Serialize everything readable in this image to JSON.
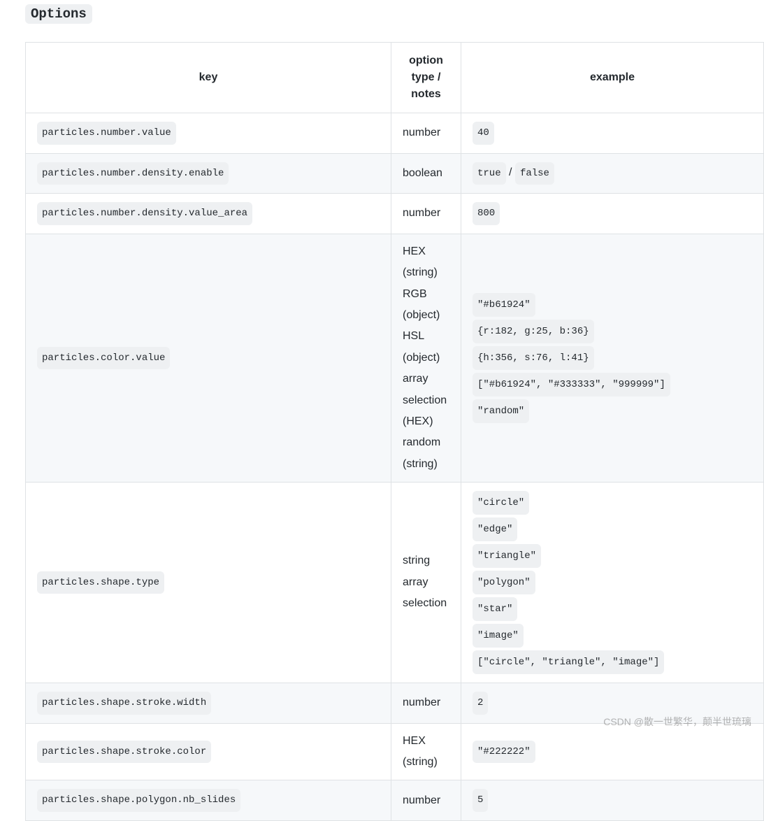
{
  "heading": "Options",
  "headers": {
    "key": "key",
    "type": "option type / notes",
    "example": "example"
  },
  "rows": [
    {
      "key": "particles.number.value",
      "type": "number",
      "examples": [
        "40"
      ],
      "example_sep": ""
    },
    {
      "key": "particles.number.density.enable",
      "type": "boolean",
      "examples": [
        "true",
        "false"
      ],
      "example_sep": " / "
    },
    {
      "key": "particles.number.density.value_area",
      "type": "number",
      "examples": [
        "800"
      ],
      "example_sep": ""
    },
    {
      "key": "particles.color.value",
      "type": "HEX (string) \nRGB (object) \nHSL (object) \narray selection (HEX) \nrandom (string)",
      "examples": [
        "\"#b61924\"",
        "{r:182, g:25, b:36}",
        "{h:356, s:76, l:41}",
        "[\"#b61924\", \"#333333\", \"999999\"]",
        "\"random\""
      ],
      "example_sep": "\n"
    },
    {
      "key": "particles.shape.type",
      "type": "string \narray selection",
      "examples": [
        "\"circle\"",
        "\"edge\"",
        "\"triangle\"",
        "\"polygon\"",
        "\"star\"",
        "\"image\"",
        "[\"circle\", \"triangle\", \"image\"]"
      ],
      "example_sep": "\n"
    },
    {
      "key": "particles.shape.stroke.width",
      "type": "number",
      "examples": [
        "2"
      ],
      "example_sep": ""
    },
    {
      "key": "particles.shape.stroke.color",
      "type": "HEX (string)",
      "examples": [
        "\"#222222\""
      ],
      "example_sep": ""
    },
    {
      "key": "particles.shape.polygon.nb_slides",
      "type": "number",
      "examples": [
        "5"
      ],
      "example_sep": ""
    }
  ],
  "watermark": "CSDN @散一世繁华，颠半世琉璃"
}
